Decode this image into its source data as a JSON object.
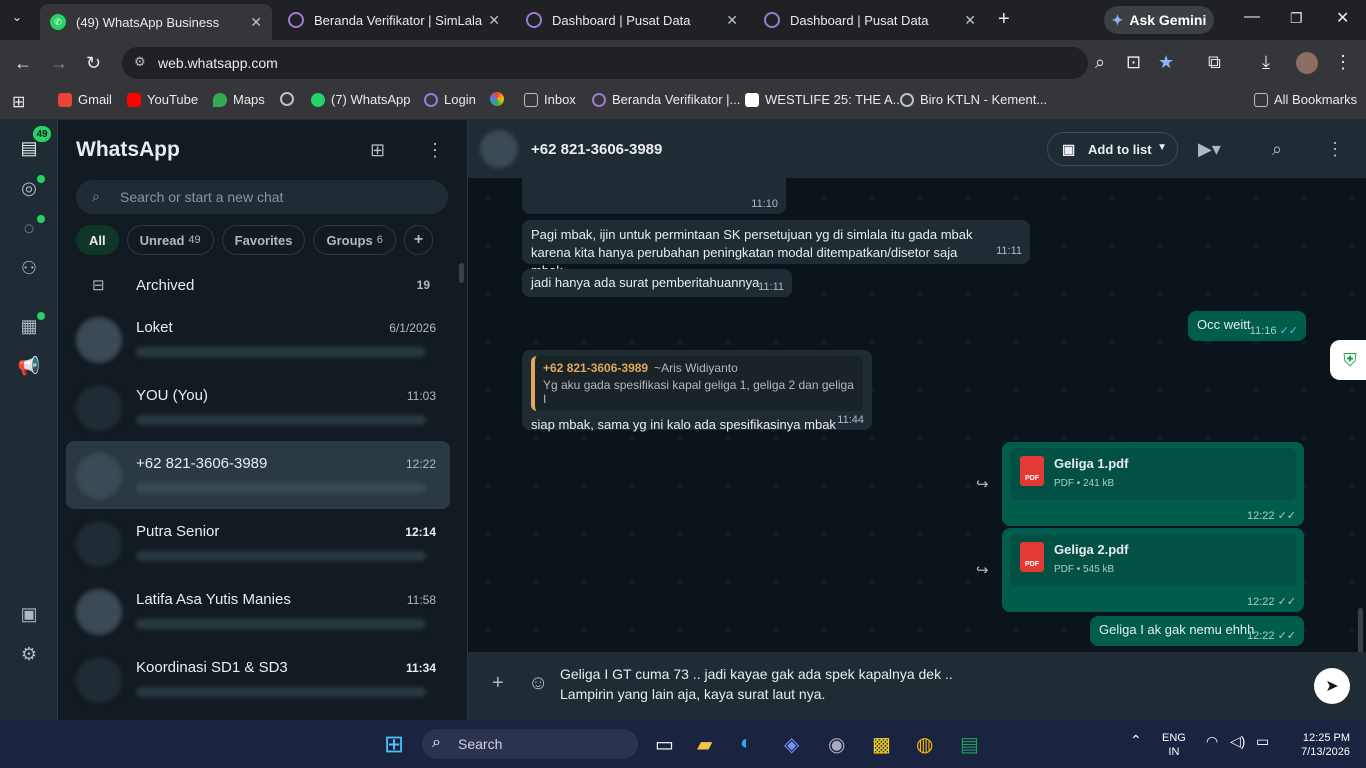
{
  "browser": {
    "tabs": [
      {
        "title": "(49) WhatsApp Business",
        "active": true
      },
      {
        "title": "Beranda Verifikator | SimLala",
        "active": false
      },
      {
        "title": "Dashboard | Pusat Data",
        "active": false
      },
      {
        "title": "Dashboard | Pusat Data",
        "active": false
      }
    ],
    "new_tab": "+",
    "ask_gemini": "Ask Gemini",
    "url": "web.whatsapp.com",
    "bookmarks": [
      "Gmail",
      "YouTube",
      "Maps",
      "(7) WhatsApp",
      "Login",
      "Inbox",
      "Beranda Verifikator |...",
      "WESTLIFE 25: THE A...",
      "Biro KTLN - Kement..."
    ],
    "all_bookmarks": "All Bookmarks"
  },
  "rail": {
    "badge": "49"
  },
  "sidebar": {
    "title": "WhatsApp",
    "search_placeholder": "Search or start a new chat",
    "filters": [
      {
        "label": "All",
        "count": ""
      },
      {
        "label": "Unread",
        "count": "49"
      },
      {
        "label": "Favorites",
        "count": ""
      },
      {
        "label": "Groups",
        "count": "6"
      }
    ],
    "add_filter": "+",
    "archived": {
      "label": "Archived",
      "count": "19"
    },
    "chats": [
      {
        "name": "Loket",
        "time": "6/1/2026",
        "bold_time": false,
        "selected": false
      },
      {
        "name": "YOU (You)",
        "time": "11:03",
        "bold_time": false,
        "selected": false
      },
      {
        "name": "+62 821-3606-3989",
        "time": "12:22",
        "bold_time": false,
        "selected": true
      },
      {
        "name": "Putra Senior",
        "time": "12:14",
        "bold_time": true,
        "selected": false
      },
      {
        "name": "Latifa Asa Yutis Manies",
        "time": "11:58",
        "bold_time": false,
        "selected": false
      },
      {
        "name": "Koordinasi SD1 & SD3",
        "time": "11:34",
        "bold_time": true,
        "selected": false
      }
    ]
  },
  "conversation": {
    "contact": "+62 821-3606-3989",
    "add_to_list": "Add to list",
    "messages": {
      "m0_time": "11:10",
      "m1_text": "Pagi mbak, ijin untuk permintaan SK persetujuan yg di simlala itu gada mbak karena kita hanya perubahan peningkatan modal ditempatkan/disetor saja mbak",
      "m1_time": "11:11",
      "m2_text": "jadi hanya ada surat pemberitahuannya",
      "m2_time": "11:11",
      "m3_text": "Occ weitt",
      "m3_time": "11:16",
      "m4_quote_number": "+62 821-3606-3989",
      "m4_quote_sender": "~Aris Widiyanto",
      "m4_quote_text": "Yg aku gada spesifikasi kapal geliga 1, geliga 2 dan geliga I",
      "m4_text": "siap mbak, sama yg ini kalo ada spesifikasinya mbak",
      "m4_time": "11:44",
      "f1_name": "Geliga 1.pdf",
      "f1_meta": "PDF • 241 kB",
      "f1_time": "12:22",
      "f2_name": "Geliga 2.pdf",
      "f2_meta": "PDF • 545 kB",
      "f2_time": "12:22",
      "m5_text": "Geliga I ak gak nemu ehhh",
      "m5_time": "12:22"
    },
    "draft": "Geliga I GT cuma 73 .. jadi kayae gak ada spek kapalnya dek ..\nLampirin yang lain aja, kaya surat laut nya."
  },
  "taskbar": {
    "search": "Search",
    "lang": "ENG",
    "region": "IN",
    "time": "12:25 PM",
    "date": "7/13/2026"
  }
}
